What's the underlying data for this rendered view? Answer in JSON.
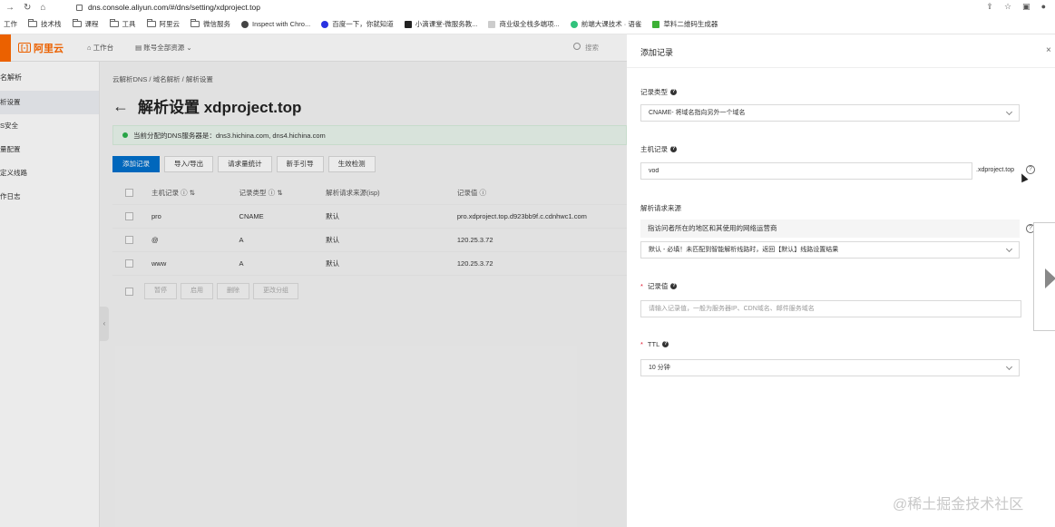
{
  "browser": {
    "url": "dns.console.aliyun.com/#/dns/setting/xdproject.top",
    "bookmarks": [
      "工作",
      "技术栈",
      "课程",
      "工具",
      "阿里云",
      "微信服务",
      "Inspect with Chro...",
      "百度一下，你就知道",
      "小滴课堂-微服务教...",
      "商业级全栈多端项...",
      "前端大课技术 · 语雀",
      "草料二维码生成器"
    ]
  },
  "topbar": {
    "logo": "阿里云",
    "workbench": "工作台",
    "resource": "账号全部资源",
    "search": "搜索"
  },
  "sidebar": {
    "title": "名解析",
    "items": [
      "析设置",
      "S安全",
      "量配置",
      "定义线路",
      "作日志"
    ]
  },
  "main": {
    "breadcrumb": "云解析DNS  /  域名解析  /  解析设置",
    "title": "解析设置 xdproject.top",
    "notice": "当前分配的DNS服务器是：dns3.hichina.com, dns4.hichina.com",
    "toolbar": [
      "添加记录",
      "导入/导出",
      "请求量统计",
      "新手引导",
      "生效检测"
    ],
    "columns": {
      "host": "主机记录",
      "type": "记录类型",
      "line": "解析请求来源(isp)",
      "value": "记录值"
    },
    "rows": [
      {
        "host": "pro",
        "type": "CNAME",
        "line": "默认",
        "value": "pro.xdproject.top.d923bb9f.c.cdnhwc1.com"
      },
      {
        "host": "@",
        "type": "A",
        "line": "默认",
        "value": "120.25.3.72"
      },
      {
        "host": "www",
        "type": "A",
        "line": "默认",
        "value": "120.25.3.72"
      }
    ],
    "footer_buttons": [
      "暂停",
      "启用",
      "删除",
      "更改分组"
    ]
  },
  "drawer": {
    "title": "添加记录",
    "close": "×",
    "record_type_label": "记录类型",
    "record_type_value": "CNAME- 将域名指向另外一个域名",
    "host_label": "主机记录",
    "host_value": "vod",
    "host_suffix": ".xdproject.top",
    "line_label": "解析请求来源",
    "line_desc": "指访问者所在的地区和其使用的网络运营商",
    "line_value": "默认 - 必填！未匹配到智能解析线路时，返回【默认】线路设置结果",
    "value_label": "记录值",
    "value_placeholder": "请输入记录值，一般为服务器IP、CDN域名、邮件服务域名",
    "ttl_label": "TTL",
    "ttl_value": "10 分钟",
    "required_mark": "*"
  },
  "watermark": "@稀土掘金技术社区"
}
